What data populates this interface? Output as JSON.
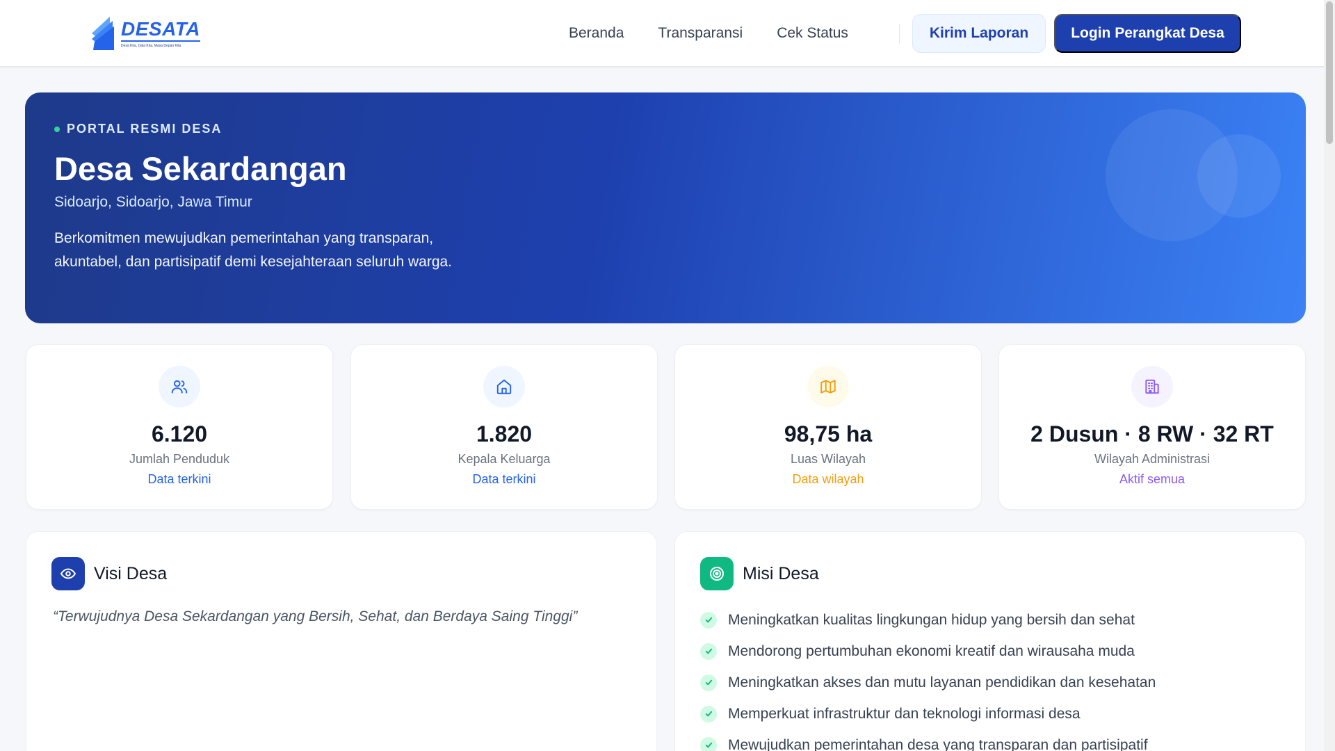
{
  "brand": {
    "name": "DESATA",
    "tagline": "Desa Kita, Data Kita, Masa Depan Kita",
    "color": "#2563eb"
  },
  "nav": {
    "links": [
      "Beranda",
      "Transparansi",
      "Cek Status"
    ],
    "report_button": "Kirim Laporan",
    "login_button": "Login Perangkat Desa"
  },
  "hero": {
    "tag": "PORTAL RESMI DESA",
    "title": "Desa Sekardangan",
    "subtitle": "Sidoarjo, Sidoarjo, Jawa Timur",
    "description": "Berkomitmen mewujudkan pemerintahan yang transparan, akuntabel, dan partisipatif demi kesejahteraan seluruh warga.",
    "gradient": [
      "#1e3a8a",
      "#1e40af",
      "#3b82f6"
    ]
  },
  "stats": [
    {
      "icon": "users-icon",
      "value": "6.120",
      "label": "Jumlah Penduduk",
      "note": "Data terkini",
      "accent": "#2563eb",
      "icon_bg": "#eff6ff"
    },
    {
      "icon": "home-icon",
      "value": "1.820",
      "label": "Kepala Keluarga",
      "note": "Data terkini",
      "accent": "#2563eb",
      "icon_bg": "#eff6ff"
    },
    {
      "icon": "map-icon",
      "value": "98,75 ha",
      "label": "Luas Wilayah",
      "note": "Data wilayah",
      "accent": "#f59e0b",
      "icon_bg": "#fffbeb"
    },
    {
      "icon": "building-icon",
      "value": "2 Dusun · 8 RW · 32 RT",
      "label": "Wilayah Administrasi",
      "note": "Aktif semua",
      "accent": "#8b5cf6",
      "icon_bg": "#f5f3ff"
    }
  ],
  "visi": {
    "title": "Visi Desa",
    "icon": "eye-icon",
    "quote": "“Terwujudnya Desa Sekardangan yang Bersih, Sehat, dan Berdaya Saing Tinggi”",
    "accent": "#1e40af"
  },
  "misi": {
    "title": "Misi Desa",
    "icon": "target-icon",
    "accent": "#10b981",
    "items": [
      "Meningkatkan kualitas lingkungan hidup yang bersih dan sehat",
      "Mendorong pertumbuhan ekonomi kreatif dan wirausaha muda",
      "Meningkatkan akses dan mutu layanan pendidikan dan kesehatan",
      "Memperkuat infrastruktur dan teknologi informasi desa",
      "Mewujudkan pemerintahan desa yang transparan dan partisipatif"
    ]
  }
}
